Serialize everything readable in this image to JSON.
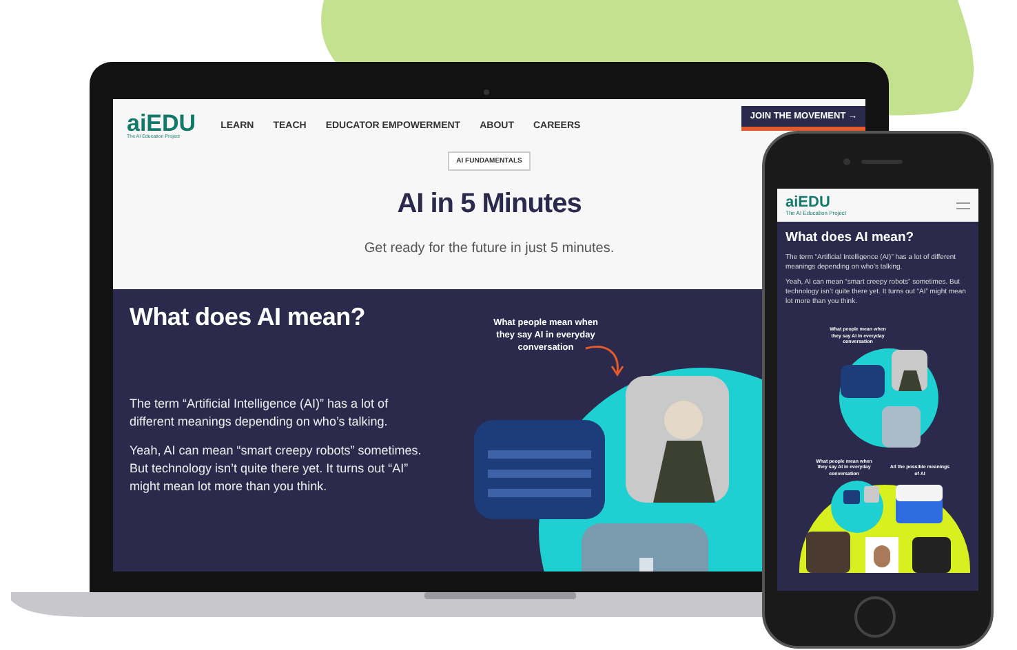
{
  "laptop": {
    "logo": {
      "name": "aiEDU",
      "tagline": "The AI Education Project"
    },
    "nav": [
      "LEARN",
      "TEACH",
      "EDUCATOR EMPOWERMENT",
      "ABOUT",
      "CAREERS"
    ],
    "cta": "JOIN THE MOVEMENT →",
    "tag": "AI FUNDAMENTALS",
    "title": "AI in 5 Minutes",
    "subtitle": "Get ready for the future in just 5 minutes.",
    "section": {
      "heading": "What does AI mean?",
      "paragraphs": [
        "The term “Artificial Intelligence (AI)” has a lot of different meanings depending on who’s talking.",
        "Yeah, AI can mean “smart creepy robots” sometimes. But technology isn’t quite there yet. It turns out “AI” might mean lot more than you think."
      ],
      "caption": "What people mean when they say AI in everyday conversation"
    }
  },
  "phone": {
    "logo": {
      "name": "aiEDU",
      "tagline": "The AI Education Project"
    },
    "heading": "What does AI mean?",
    "paragraphs": [
      "The term “Artificial Intelligence (AI)” has a lot of different meanings depending on who’s talking.",
      "Yeah, AI can mean “smart creepy robots” sometimes. But technology isn’t quite there yet. It turns out “AI” might mean lot more than you think."
    ],
    "captions": [
      "What people mean when they say AI in everyday conversation",
      "What people mean when they say AI in everyday conversation",
      "All the possible meanings of AI"
    ]
  }
}
